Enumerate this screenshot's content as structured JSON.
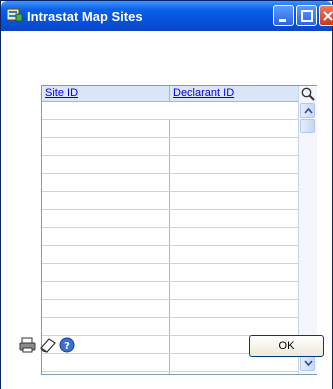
{
  "window": {
    "title": "Intrastat Map Sites"
  },
  "grid": {
    "columns": [
      "Site ID",
      "Declarant ID"
    ],
    "rows": [
      [
        "",
        ""
      ],
      [
        "",
        ""
      ],
      [
        "",
        ""
      ],
      [
        "",
        ""
      ],
      [
        "",
        ""
      ],
      [
        "",
        ""
      ],
      [
        "",
        ""
      ],
      [
        "",
        ""
      ],
      [
        "",
        ""
      ],
      [
        "",
        ""
      ],
      [
        "",
        ""
      ],
      [
        "",
        ""
      ],
      [
        "",
        ""
      ],
      [
        "",
        ""
      ],
      [
        "",
        ""
      ]
    ]
  },
  "footer": {
    "icons": [
      "printer-icon",
      "note-icon",
      "help-icon"
    ],
    "ok_label": "OK"
  },
  "colors": {
    "titlebar": "#0651d8",
    "header_bg": "#dbe6f8",
    "link": "#0000ee"
  }
}
